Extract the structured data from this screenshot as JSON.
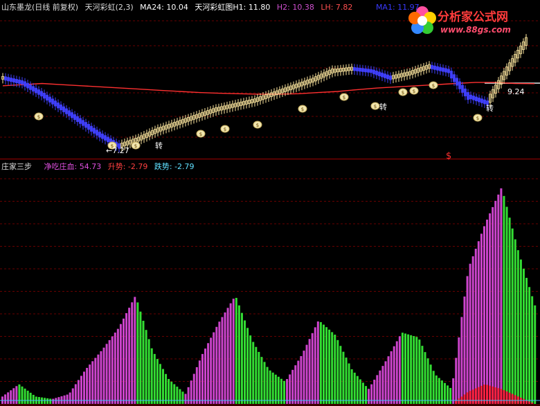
{
  "top_panel": {
    "stock_name": "山东墨龙",
    "period": "(日线 前复权)",
    "indicator": "天河彩虹(2,3)",
    "ma24": "MA24: 10.04",
    "rainbow_label": "天河彩虹图",
    "h1": "H1: 11.80",
    "h2": "H2: 10.38",
    "lh": "LH: 7.82",
    "ma1": "MA1: 11.97",
    "turn_label": "转",
    "low_price_label": "←7.27",
    "high_price_label": "9.24",
    "money_symbol": "$"
  },
  "bottom_panel": {
    "title": "庄家三步",
    "net_eat": "净吃庄血: 54.73",
    "rise": "升势: -2.79",
    "fall": "跌势: -2.79"
  },
  "logo": {
    "text": "分析家公式网",
    "url": "www.88gs.com"
  },
  "colors": {
    "ma24": "#ff3030",
    "candle_up": "#ffe9a0",
    "candle_down": "#4040ff",
    "green_bar": "#33dd33",
    "magenta_bar": "#cc44cc",
    "red_bar": "#ff2040",
    "grid": "#6a0000"
  },
  "chart_data": [
    {
      "type": "line",
      "title": "天河彩虹图",
      "series": [
        {
          "name": "MA24",
          "values": [
            9.95,
            10.0,
            10.05,
            10.0,
            9.95,
            9.9,
            9.85,
            9.8,
            9.75,
            9.7,
            9.65,
            9.62,
            9.6,
            9.58,
            9.58,
            9.6,
            9.65,
            9.7,
            9.78,
            9.85,
            9.9,
            9.95,
            10.0,
            10.05,
            10.1,
            10.1,
            10.05,
            10.04
          ]
        },
        {
          "name": "Price",
          "values": [
            10.3,
            10.1,
            9.6,
            9.0,
            8.4,
            7.8,
            7.3,
            7.6,
            8.0,
            8.3,
            8.6,
            8.9,
            9.1,
            9.3,
            9.6,
            9.9,
            10.2,
            10.6,
            10.7,
            10.6,
            10.3,
            10.5,
            10.8,
            10.6,
            9.5,
            9.2,
            10.6,
            11.9
          ]
        }
      ],
      "annotations": [
        "←7.27",
        "9.24",
        "转"
      ]
    },
    {
      "type": "bar",
      "title": "庄家三步",
      "series": [
        {
          "name": "净吃庄血",
          "values": [
            3,
            8,
            3,
            2,
            4,
            14,
            22,
            31,
            44,
            22,
            10,
            4,
            20,
            33,
            44,
            26,
            14,
            9,
            20,
            34,
            28,
            14,
            6,
            17,
            29,
            27,
            12,
            6,
            55,
            73,
            88,
            62,
            40
          ]
        },
        {
          "name": "升势",
          "values": [
            0,
            0,
            0,
            0,
            0,
            0,
            0,
            0,
            0,
            0,
            0,
            0,
            0,
            0,
            0,
            0,
            0,
            0,
            0,
            0,
            0,
            0,
            0,
            0,
            0,
            0,
            0,
            0,
            5,
            8,
            6,
            3,
            0
          ]
        },
        {
          "name": "跌势",
          "values": [
            0,
            0,
            0,
            0,
            0,
            0,
            0,
            0,
            0,
            0,
            0,
            0,
            0,
            0,
            0,
            0,
            0,
            0,
            0,
            0,
            0,
            0,
            0,
            0,
            0,
            0,
            0,
            0,
            0,
            0,
            0,
            0,
            0
          ]
        }
      ]
    }
  ]
}
